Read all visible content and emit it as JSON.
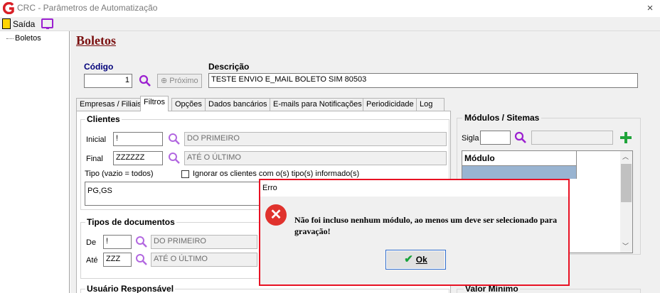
{
  "window": {
    "title": "CRC - Parâmetros de Automatização",
    "close_glyph": "×"
  },
  "menu": {
    "saida_label": "Saída"
  },
  "tree": {
    "items": [
      {
        "label": "Boletos"
      }
    ]
  },
  "page": {
    "heading": "Boletos",
    "codigo_label": "Código",
    "codigo_value": "1",
    "proximo_label": "Próximo",
    "descricao_label": "Descrição",
    "descricao_value": "TESTE ENVIO  E_MAIL BOLETO SIM 80503"
  },
  "tabs": [
    {
      "label": "Empresas / Filiais",
      "active": false
    },
    {
      "label": "Filtros",
      "active": true
    },
    {
      "label": "Opções",
      "active": false
    },
    {
      "label": "Dados bancários",
      "active": false
    },
    {
      "label": "E-mails para Notificações",
      "active": false
    },
    {
      "label": "Periodicidade",
      "active": false
    },
    {
      "label": "Log",
      "active": false
    }
  ],
  "clientes": {
    "title": "Clientes",
    "inicial_label": "Inicial",
    "inicial_value": "!",
    "inicial_desc": "DO PRIMEIRO",
    "final_label": "Final",
    "final_value": "ZZZZZZ",
    "final_desc": "ATÉ O ÚLTIMO",
    "tipo_label": "Tipo (vazio = todos)",
    "ignorar_label": "Ignorar os clientes com o(s) tipo(s) informado(s)",
    "tipo_value": "PG,GS"
  },
  "tipos_documentos": {
    "title": "Tipos de documentos",
    "de_label": "De",
    "de_value": "!",
    "de_desc": "DO PRIMEIRO",
    "ate_label": "Até",
    "ate_value": "ZZZ",
    "ate_desc": "ATÉ O ÚLTIMO"
  },
  "usuario": {
    "title": "Usuário Responsável"
  },
  "modulos": {
    "title": "Módulos / Sitemas",
    "sigla_label": "Sigla",
    "sigla_value": "",
    "grid_header": "Módulo"
  },
  "valor_minimo": {
    "title": "Valor Mínimo"
  },
  "dialog": {
    "title": "Erro",
    "message": "Não foi incluso nenhum módulo, ao menos um deve ser selecionado para gravação!",
    "ok_label": "Ok"
  },
  "colors": {
    "dialog_border": "#e81123",
    "heading": "#7a1010",
    "search_icon": "#9b1fd0",
    "selected_row": "#99b4d1"
  }
}
